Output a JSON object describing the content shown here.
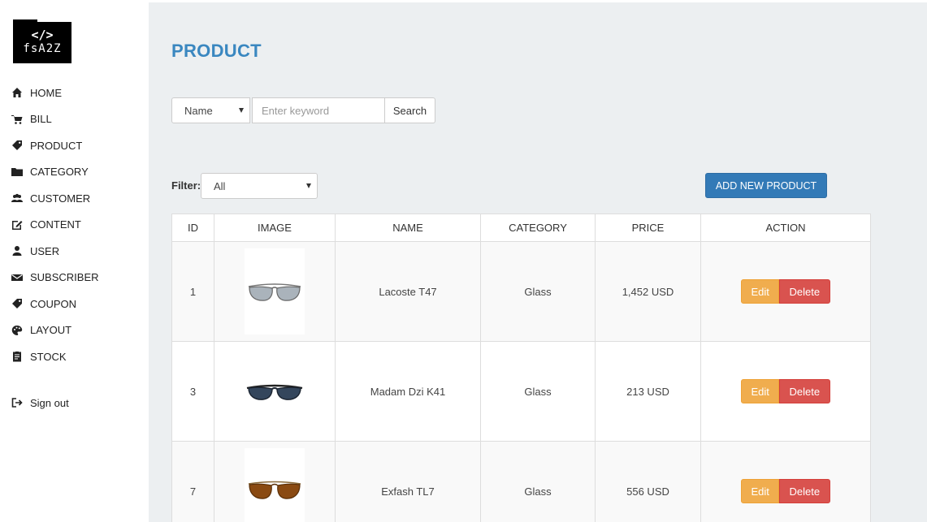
{
  "logo": {
    "line1": "</>",
    "line2": "fsA2Z"
  },
  "sidebar": {
    "items": [
      {
        "label": "HOME",
        "icon": "home-icon"
      },
      {
        "label": "BILL",
        "icon": "cart-icon"
      },
      {
        "label": "PRODUCT",
        "icon": "tag-icon"
      },
      {
        "label": "CATEGORY",
        "icon": "folder-icon"
      },
      {
        "label": "CUSTOMER",
        "icon": "users-icon"
      },
      {
        "label": "CONTENT",
        "icon": "edit-icon"
      },
      {
        "label": "USER",
        "icon": "user-icon"
      },
      {
        "label": "SUBSCRIBER",
        "icon": "envelope-icon"
      },
      {
        "label": "COUPON",
        "icon": "tag-icon"
      },
      {
        "label": "LAYOUT",
        "icon": "palette-icon"
      },
      {
        "label": "STOCK",
        "icon": "clipboard-icon"
      }
    ],
    "signout": {
      "label": "Sign out",
      "icon": "sign-out-icon"
    }
  },
  "main": {
    "title": "PRODUCT",
    "search": {
      "field_selected": "Name",
      "placeholder": "Enter keyword",
      "button": "Search"
    },
    "filter": {
      "label": "Filter:",
      "selected": "All"
    },
    "add_button": "ADD NEW PRODUCT",
    "table": {
      "headers": [
        "ID",
        "IMAGE",
        "NAME",
        "CATEGORY",
        "PRICE",
        "ACTION"
      ],
      "rows": [
        {
          "id": "1",
          "image": "sunglasses-silver",
          "name": "Lacoste T47",
          "category": "Glass",
          "price": "1,452 USD"
        },
        {
          "id": "3",
          "image": "sunglasses-blue",
          "name": "Madam Dzi K41",
          "category": "Glass",
          "price": "213 USD"
        },
        {
          "id": "7",
          "image": "sunglasses-brown",
          "name": "Exfash TL7",
          "category": "Glass",
          "price": "556 USD"
        }
      ],
      "edit_label": "Edit",
      "delete_label": "Delete"
    }
  },
  "colors": {
    "title": "#3a87c0",
    "primary": "#337ab7",
    "warning": "#f0ad4e",
    "danger": "#d9534f",
    "content_bg": "#eceff1",
    "lens_silver": "#9aa4ad",
    "lens_blue": "#2f3f52",
    "lens_brown": "#8a4a12"
  }
}
